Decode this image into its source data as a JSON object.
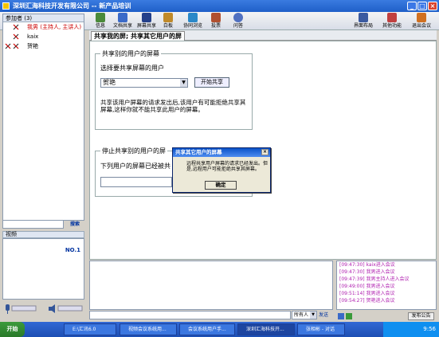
{
  "window": {
    "title": "深圳汇海科技开发有限公司 -- 新产品培训"
  },
  "toolbar": {
    "left_items": [
      "信息",
      "文档共享",
      "屏幕共享",
      "白板",
      "协同浏览",
      "投票",
      "问答"
    ],
    "right_items": [
      "界面布局",
      "其他功能",
      "退出会议"
    ]
  },
  "participants": {
    "header": "参加者 (3)",
    "rows": [
      {
        "name": "我男 (主持人, 主讲人)"
      },
      {
        "name": "kaix"
      },
      {
        "name": "贺艳"
      }
    ]
  },
  "search": {
    "button": "搜索"
  },
  "video": {
    "header": "视频",
    "slot": "NO.1"
  },
  "main": {
    "tab": "共享我的屏; 共享其它用户的屏",
    "share_group": {
      "title": "共享别的用户的屏幕",
      "prompt": "选择要共享屏幕的用户",
      "selected_user": "贺艳",
      "start_button": "开始共享",
      "note": "共享该用户屏幕的请求发出后,该用户有可能拒绝共享其屏幕,这样你就不能共享此用户的屏幕。"
    },
    "stop_group": {
      "title": "停止共享别的用户的屏",
      "prompt": "下列用户的屏幕已经被共"
    }
  },
  "dialog": {
    "title": "共享其它用户的屏幕",
    "message": "远程共享用户屏幕的请求已经发出。但是,远程用户可能拒绝共享其屏幕。",
    "ok": "确定"
  },
  "log": {
    "lines": [
      "[09:47:30] kaix进入会议",
      "[09:47:30] 我男进入会议",
      "[09:47:39] 我男主持人进入会议",
      "[09:49:00] 我男进入会议",
      "[09:51:14] 我男进入会议",
      "[09:54:27] 贺艳进入会议"
    ]
  },
  "chat": {
    "recipient": "所有人",
    "send": "发送",
    "publish": "发布公告"
  },
  "taskbar": {
    "start": "开始",
    "items": [
      "E:\\汇讯6.0",
      "视频会议系统用...",
      "会议系统用户手...",
      "深圳汇海科技开...",
      "张相彬 - 对话"
    ],
    "clock": "9:56"
  },
  "colors": {
    "titlebar": "#1f5fc8",
    "log_text": "#b020b0",
    "highlight_red": "#cc0000"
  }
}
